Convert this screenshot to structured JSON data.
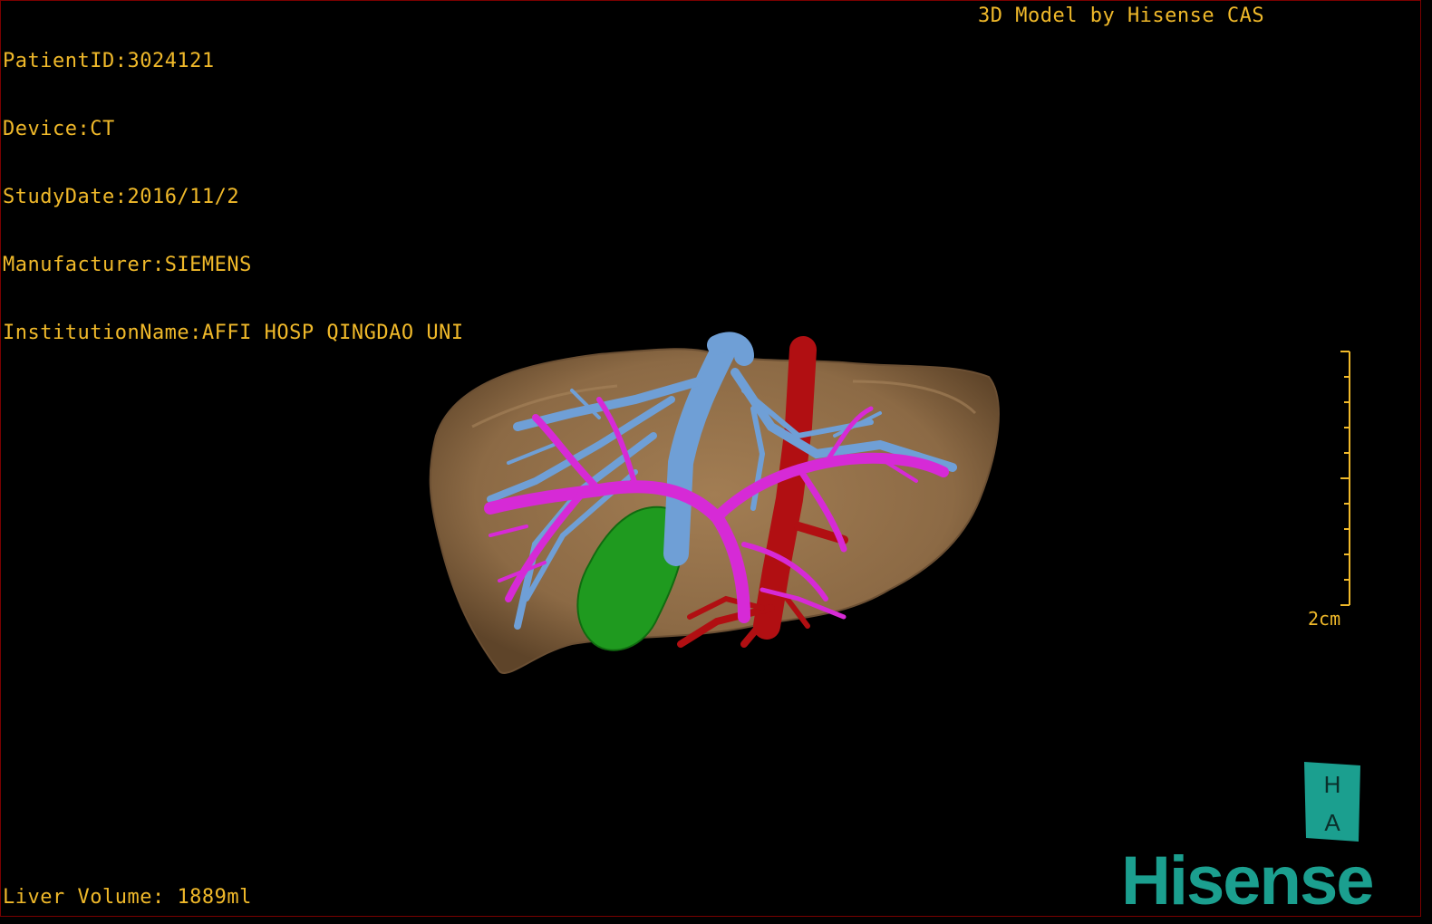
{
  "header": {
    "patient_label": "PatientID:",
    "patient_id": "3024121",
    "device_label": "Device:",
    "device": "CT",
    "study_date_label": "StudyDate:",
    "study_date": "2016/11/2",
    "manufacturer_label": "Manufacturer:",
    "manufacturer": "SIEMENS",
    "institution_label": "InstitutionName:",
    "institution": "AFFI HOSP QINGDAO UNI",
    "credit": "3D Model by Hisense CAS"
  },
  "scale": {
    "label": "2cm"
  },
  "footer": {
    "volume_label": "Liver Volume: ",
    "volume_value": "1889ml"
  },
  "logo": {
    "badge_top": "H",
    "badge_bottom": "A",
    "wordmark": "Hisense"
  },
  "colors": {
    "overlay_text": "#f0b92a",
    "liver": "#8c6a45",
    "hepatic_vein": "#6f9fd6",
    "portal_vein": "#d62ad6",
    "artery_ivc": "#b10f12",
    "gallbladder": "#1f9a1f",
    "brand": "#1b9f8f"
  },
  "model_icons": [
    "liver-model-icon",
    "hepatic-vein-icon",
    "portal-vein-icon",
    "ivc-artery-icon",
    "gallbladder-icon"
  ]
}
